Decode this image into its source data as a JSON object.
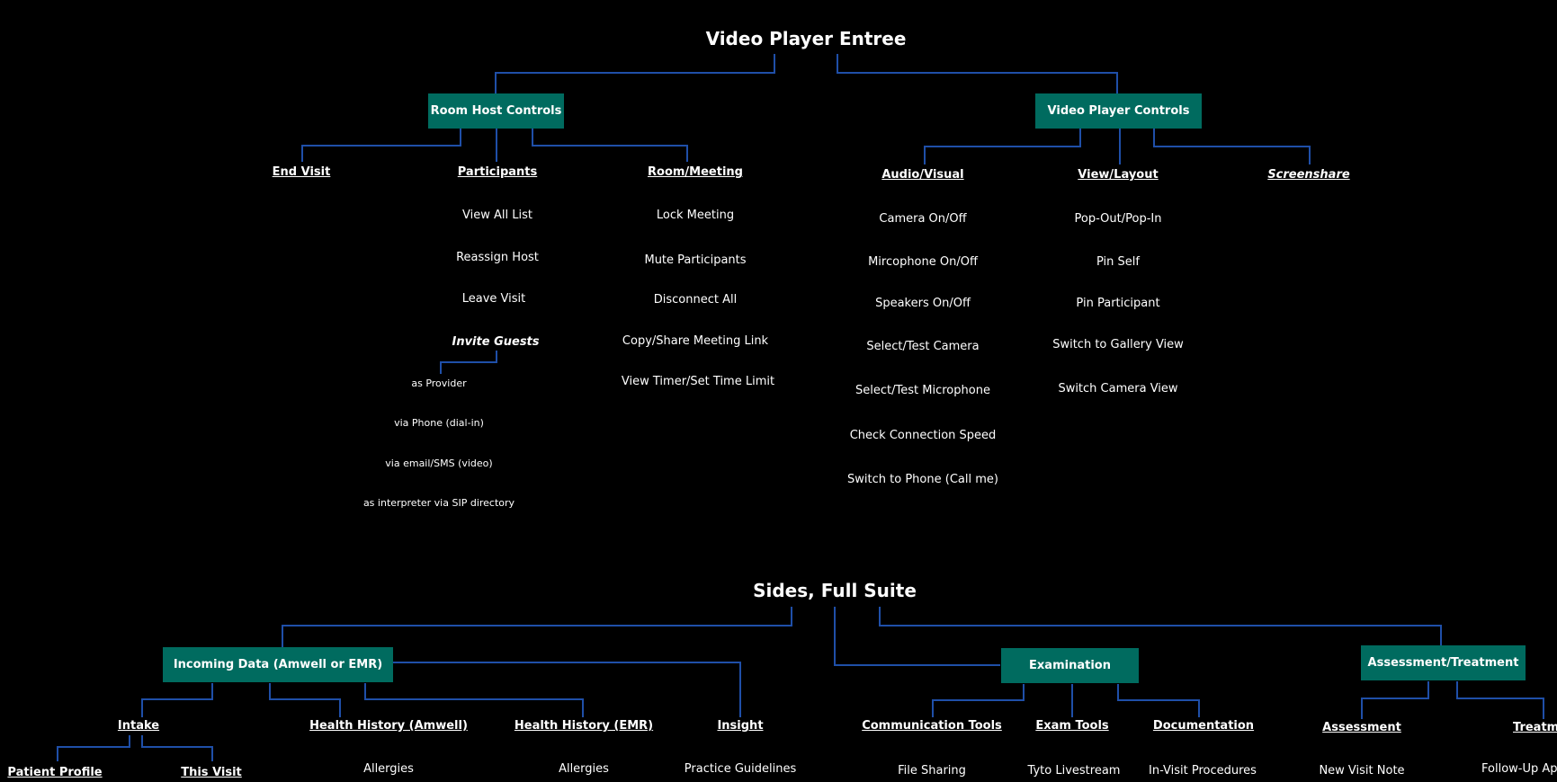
{
  "top": {
    "title": "Video Player Entree",
    "room_host_controls": "Room Host Controls",
    "video_player_controls": "Video Player Controls",
    "end_visit": "End Visit",
    "participants": {
      "header": "Participants",
      "items": [
        "View All List",
        "Reassign Host",
        "Leave Visit"
      ],
      "invite_guests": "Invite Guests",
      "invite_items": [
        "as Provider",
        "via Phone (dial-in)",
        "via email/SMS (video)",
        "as interpreter via SIP directory"
      ]
    },
    "room_meeting": {
      "header": "Room/Meeting",
      "items": [
        "Lock Meeting",
        "Mute Participants",
        "Disconnect All",
        "Copy/Share Meeting Link",
        "View Timer/Set Time Limit"
      ]
    },
    "audio_visual": {
      "header": "Audio/Visual",
      "items": [
        "Camera On/Off",
        "Mircophone On/Off",
        "Speakers On/Off",
        "Select/Test Camera",
        "Select/Test Microphone",
        "Check Connection Speed",
        "Switch to Phone (Call me)"
      ]
    },
    "view_layout": {
      "header": "View/Layout",
      "items": [
        "Pop-Out/Pop-In",
        "Pin Self",
        "Pin Participant",
        "Switch to Gallery View",
        "Switch Camera View"
      ]
    },
    "screenshare": "Screenshare"
  },
  "bottom": {
    "title": "Sides, Full Suite",
    "incoming_data": "Incoming Data (Amwell or EMR)",
    "examination": "Examination",
    "assessment_treatment": "Assessment/Treatment",
    "intake": "Intake",
    "patient_profile": "Patient Profile",
    "this_visit": "This Visit",
    "health_history_amwell": {
      "header": "Health History (Amwell)",
      "items": [
        "Allergies"
      ]
    },
    "health_history_emr": {
      "header": "Health History (EMR)",
      "items": [
        "Allergies"
      ]
    },
    "insight": {
      "header": "Insight",
      "items": [
        "Practice Guidelines"
      ]
    },
    "communication_tools": {
      "header": "Communication Tools",
      "items": [
        "File Sharing"
      ]
    },
    "exam_tools": {
      "header": "Exam Tools",
      "items": [
        "Tyto Livestream"
      ]
    },
    "documentation": {
      "header": "Documentation",
      "items": [
        "In-Visit Procedures"
      ]
    },
    "assessment": {
      "header": "Assessment",
      "items": [
        "New Visit Note"
      ]
    },
    "treatment": {
      "header": "Treatme",
      "items": [
        "Follow-Up App"
      ]
    }
  },
  "colors": {
    "background": "#000000",
    "box": "#006b5f",
    "connector": "#1f4fa8",
    "text": "#ffffff"
  }
}
